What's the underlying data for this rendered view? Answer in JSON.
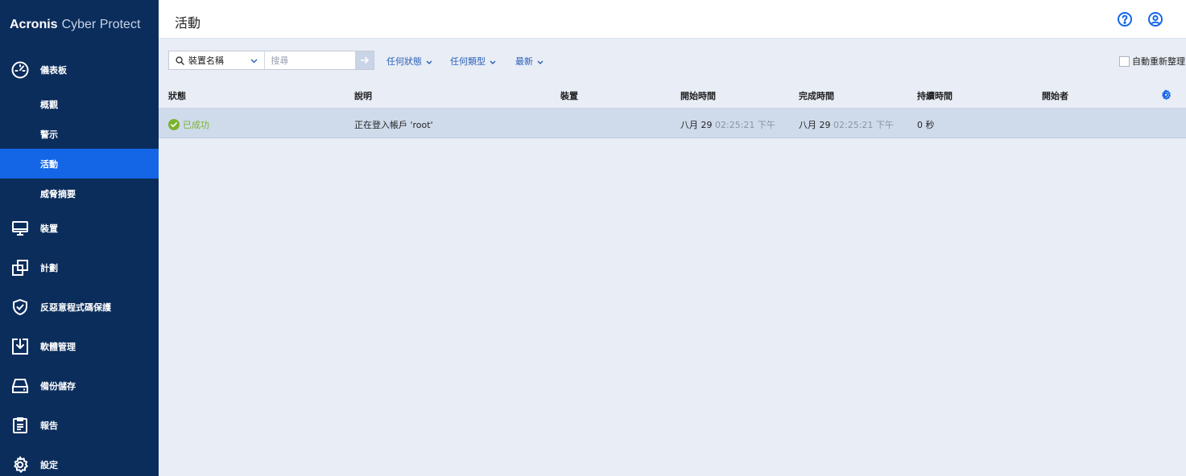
{
  "brand": {
    "part1": "Acronis",
    "part2": "Cyber Protect"
  },
  "sidebar": {
    "items": [
      {
        "label": "儀表板",
        "icon": "dashboard-gauge-icon"
      },
      {
        "label": "概觀"
      },
      {
        "label": "警示"
      },
      {
        "label": "活動"
      },
      {
        "label": "威脅摘要"
      },
      {
        "label": "裝置",
        "icon": "monitor-icon"
      },
      {
        "label": "計劃",
        "icon": "plans-icon"
      },
      {
        "label": "反惡意程式碼保護",
        "icon": "shield-check-icon"
      },
      {
        "label": "軟體管理",
        "icon": "software-management-icon"
      },
      {
        "label": "備份儲存",
        "icon": "backup-storage-icon"
      },
      {
        "label": "報告",
        "icon": "report-icon"
      },
      {
        "label": "設定",
        "icon": "settings-gear-icon"
      }
    ]
  },
  "header": {
    "title": "活動",
    "icons": [
      "help-icon",
      "account-icon"
    ]
  },
  "toolbar": {
    "search_field": "裝置名稱",
    "search_placeholder": "搜尋",
    "filter_status": "任何狀態",
    "filter_type": "任何類型",
    "filter_sort": "最新",
    "auto_sort": "自動重新整理"
  },
  "table": {
    "columns": [
      "狀態",
      "說明",
      "裝置",
      "開始時間",
      "完成時間",
      "持續時間",
      "開始者"
    ],
    "rows": [
      {
        "status": "已成功",
        "description": "正在登入帳戶 'root'",
        "device": "",
        "start_date": "八月 29",
        "start_time": "02:25:21 下午",
        "end_date": "八月 29",
        "end_time": "02:25:21 下午",
        "duration": "0 秒",
        "started_by": ""
      }
    ]
  },
  "colors": {
    "sidebar_bg": "#0b2d5c",
    "active_item": "#1466e6",
    "success": "#7ab32e",
    "link": "#2a5fb5"
  }
}
